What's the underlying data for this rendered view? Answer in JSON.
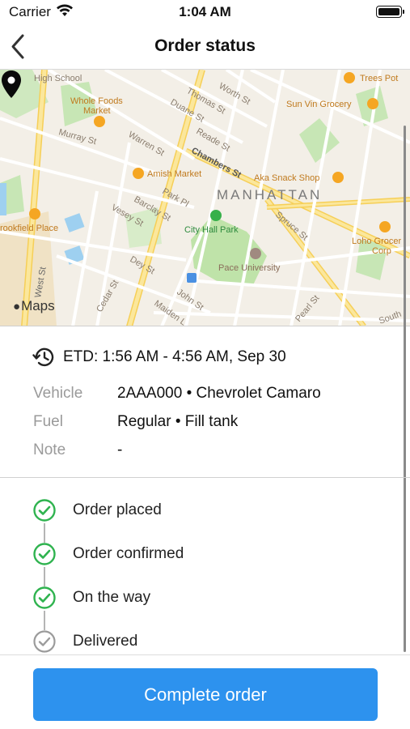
{
  "status_bar": {
    "carrier": "Carrier",
    "time": "1:04 AM"
  },
  "nav": {
    "title": "Order status",
    "back_icon": "chevron-left-icon"
  },
  "map": {
    "labels": {
      "high_school": "High School",
      "whole_foods": "Whole Foods",
      "market": "Market",
      "trees_pot": "Trees Pot",
      "worth_st": "Worth St",
      "thomas_st": "Thomas St",
      "duane_st": "Duane St",
      "sun_vin": "Sun Vin Grocery",
      "murray_st": "Murray St",
      "warren_st": "Warren St",
      "reade_st": "Reade St",
      "chambers_st": "Chambers St",
      "amish_market": "Amish Market",
      "aka_snack": "Aka Snack Shop",
      "manhattan": "MANHATTAN",
      "park_pl": "Park Pl",
      "barclay_st": "Barclay St",
      "vesey_st": "Vesey St",
      "city_hall_park": "City Hall Park",
      "brookfield": "rookfield Place",
      "loho": "Loho Grocer",
      "corp": "Corp",
      "pace": "Pace University",
      "dey_st": "Dey St",
      "west_st": "West St",
      "john_st": "John St",
      "maiden_l": "Maiden L",
      "cedar_st": "Cedar St",
      "pearl_st": "Pearl St",
      "south_st": "South",
      "spruce_st": "Spruce St"
    },
    "logo": "Maps",
    "pin_icon": "location-pin-icon"
  },
  "etd": {
    "icon": "history-clock-icon",
    "text": "ETD: 1:56 AM - 4:56 AM, Sep 30"
  },
  "info": [
    {
      "label": "Vehicle",
      "value": "2AAA000 • Chevrolet Camaro"
    },
    {
      "label": "Fuel",
      "value": "Regular • Fill tank"
    },
    {
      "label": "Note",
      "value": "-"
    }
  ],
  "timeline": {
    "steps": [
      {
        "label": "Order placed",
        "state": "done"
      },
      {
        "label": "Order confirmed",
        "state": "done"
      },
      {
        "label": "On the way",
        "state": "done"
      },
      {
        "label": "Delivered",
        "state": "pending"
      }
    ],
    "done_color": "#2fb34f",
    "pending_color": "#9b9b9b"
  },
  "action": {
    "label": "Complete order",
    "color": "#2d92ee"
  }
}
